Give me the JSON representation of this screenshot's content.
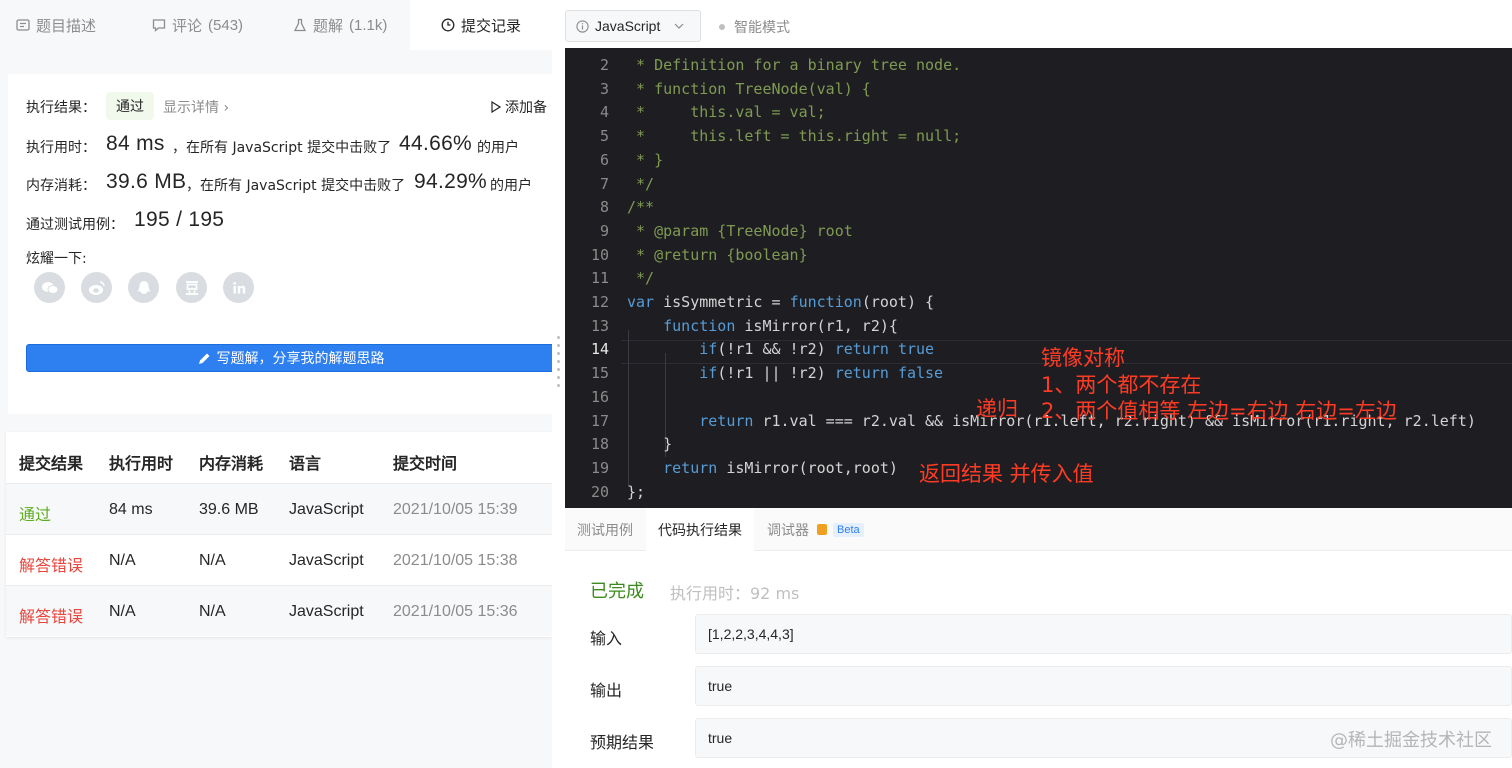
{
  "left_tabs": [
    {
      "label": "题目描述",
      "count": ""
    },
    {
      "label": "评论",
      "count": "(543)"
    },
    {
      "label": "题解",
      "count": "(1.1k)"
    },
    {
      "label": "提交记录",
      "count": ""
    }
  ],
  "result": {
    "exec_result_label": "执行结果：",
    "status": "通过",
    "show_detail": "显示详情 ›",
    "add_note": "添加备",
    "runtime_label": "执行用时：",
    "runtime_value": "84 ms",
    "runtime_text": "，在所有 JavaScript 提交中击败了",
    "runtime_percent": "44.66%",
    "runtime_users": "的用户",
    "memory_label": "内存消耗：",
    "memory_value": "39.6 MB",
    "memory_text": "，在所有 JavaScript 提交中击败了",
    "memory_percent": "94.29%",
    "memory_users": "的用户",
    "tests_label": "通过测试用例：",
    "tests_value": "195 / 195",
    "share_label": "炫耀一下:",
    "share_icons": [
      "wechat-icon",
      "weibo-icon",
      "qq-icon",
      "douban-icon",
      "linkedin-icon"
    ],
    "write_solution": "写题解，分享我的解题思路"
  },
  "submissions": {
    "headers": [
      "提交结果",
      "执行用时",
      "内存消耗",
      "语言",
      "提交时间"
    ],
    "rows": [
      {
        "status": "通过",
        "status_type": "pass",
        "runtime": "84 ms",
        "memory": "39.6 MB",
        "lang": "JavaScript",
        "time": "2021/10/05 15:39"
      },
      {
        "status": "解答错误",
        "status_type": "fail",
        "runtime": "N/A",
        "memory": "N/A",
        "lang": "JavaScript",
        "time": "2021/10/05 15:38"
      },
      {
        "status": "解答错误",
        "status_type": "fail",
        "runtime": "N/A",
        "memory": "N/A",
        "lang": "JavaScript",
        "time": "2021/10/05 15:36"
      }
    ]
  },
  "editor": {
    "language": "JavaScript",
    "smart_mode": "智能模式",
    "current_line": 14,
    "lines": [
      {
        "n": 2,
        "text": " * Definition for a binary tree node.",
        "type": "comment"
      },
      {
        "n": 3,
        "text": " * function TreeNode(val) {",
        "type": "comment"
      },
      {
        "n": 4,
        "text": " *     this.val = val;",
        "type": "comment"
      },
      {
        "n": 5,
        "text": " *     this.left = this.right = null;",
        "type": "comment"
      },
      {
        "n": 6,
        "text": " * }",
        "type": "comment"
      },
      {
        "n": 7,
        "text": " */",
        "type": "comment"
      },
      {
        "n": 8,
        "text": "/**",
        "type": "comment"
      },
      {
        "n": 9,
        "text": " * @param {TreeNode} root",
        "type": "comment"
      },
      {
        "n": 10,
        "text": " * @return {boolean}",
        "type": "comment"
      },
      {
        "n": 11,
        "text": " */",
        "type": "comment"
      },
      {
        "n": 12,
        "text": "var isSymmetric = function(root) {",
        "type": "code"
      },
      {
        "n": 13,
        "text": "    function isMirror(r1, r2){",
        "type": "code"
      },
      {
        "n": 14,
        "text": "        if(!r1 && !r2) return true",
        "type": "code"
      },
      {
        "n": 15,
        "text": "        if(!r1 || !r2) return false",
        "type": "code"
      },
      {
        "n": 16,
        "text": "",
        "type": "code"
      },
      {
        "n": 17,
        "text": "        return r1.val === r2.val && isMirror(r1.left, r2.right) && isMirror(r1.right, r2.left)",
        "type": "code"
      },
      {
        "n": 18,
        "text": "    }",
        "type": "code"
      },
      {
        "n": 19,
        "text": "    return isMirror(root,root)",
        "type": "code"
      },
      {
        "n": 20,
        "text": "};",
        "type": "code"
      }
    ],
    "annotations": {
      "mirror": "镜像对称",
      "point1": "1、两个都不存在",
      "recursion": "递归",
      "point2": "2、两个值相等 左边=右边 右边=左边",
      "return_note": "返回结果 并传入值"
    }
  },
  "bottom": {
    "tabs": [
      "测试用例",
      "代码执行结果",
      "调试器"
    ],
    "beta": "Beta",
    "done": "已完成",
    "exec_time": "执行用时：92 ms",
    "input_label": "输入",
    "input_value": "[1,2,2,3,4,4,3]",
    "output_label": "输出",
    "output_value": "true",
    "expected_label": "预期结果",
    "expected_value": "true",
    "watermark": "@稀土掘金技术社区"
  },
  "colors": {
    "accent": "#2e7ff0",
    "pass": "#5dae1c",
    "fail": "#e8453c",
    "editor_bg": "#1e1e22",
    "annotation": "#ff3b24"
  }
}
